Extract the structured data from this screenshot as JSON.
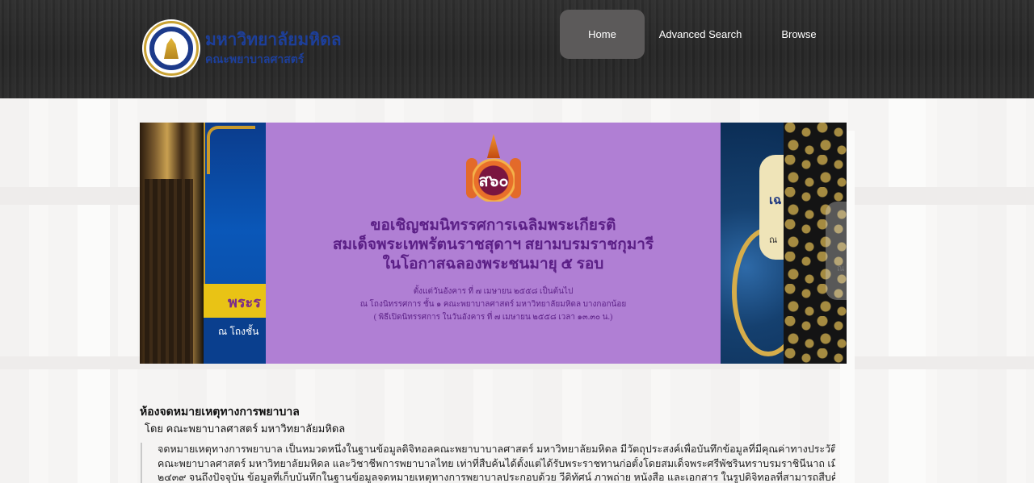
{
  "header": {
    "brand_title": "มหาวิทยาลัยมหิดล",
    "brand_subtitle": "คณะพยาบาลศาสตร์",
    "seal_icon": "mahidol-university-seal-icon"
  },
  "nav": {
    "items": [
      {
        "label": "Home",
        "active": true
      },
      {
        "label": "Advanced Search",
        "active": false
      },
      {
        "label": "Browse",
        "active": false
      }
    ]
  },
  "carousel": {
    "main_slide": {
      "line1": "ขอเชิญชมนิทรรศการเฉลิมพระเกียรติ",
      "line2": "สมเด็จพระเทพรัตนราชสุดาฯ สยามบรมราชกุมารี",
      "line3": "ในโอกาสฉลองพระชนมายุ ๕ รอบ",
      "detail1": "ตั้งแต่วันอังคาร ที่ ๗ เมษายน ๒๕๕๘ เป็นต้นไป",
      "detail2": "ณ โถงนิทรรศการ ชั้น ๑ คณะพยาบาลศาสตร์ มหาวิทยาลัยมหิดล บางกอกน้อย",
      "detail3": "( พิธีเปิดนิทรรศการ ในวันอังคาร ที่ ๗ เมษายน ๒๕๕๘ เวลา ๑๓.๓๐ น.)",
      "emblem_glyph": "ส๖๐"
    },
    "left_slide": {
      "yellow_text": "พระร",
      "blue_text": "ณ โถงชั้น"
    },
    "right_slide": {
      "frame_text": "เฉ",
      "frame_sub": "ณ"
    },
    "far_right_slide": {
      "panel_text": "ณ"
    },
    "colors": {
      "main_bg": "#b07fd4",
      "main_text": "#5b1f86"
    }
  },
  "content": {
    "title": "ห้องจดหมายเหตุทางการพยาบาล",
    "byline": "โดย คณะพยาบาลศาสตร์ มหาวิทยาลัยมหิดล",
    "paragraph_lines": [
      "จดหมายเหตุทางการพยาบาล เป็นหมวดหนึ่งในฐานข้อมูลดิจิทอลคณะพยาบาบาลศาสตร์ มหาวิทยาลัยมหิดล มีวัตถุประสงค์เพื่อบันทึกข้อมูลที่มีคุณค่าทางประวัติศาสตร์ของ",
      "คณะพยาบาลศาสตร์ มหาวิทยาลัยมหิดล และวิชาชีพการพยาบาลไทย เท่าที่สืบค้นได้ตั้งแต่ได้รับพระราชทานก่อตั้งโดยสมเด็จพระศรีพัชรินทราบรมราชินีนาถ เมื่อพุทธศักราช",
      "๒๔๓๙ จนถึงปัจจุบัน ข้อมูลที่เก็บบันทึกในฐานข้อมูลจดหมายเหตุทางการพยาบาลประกอบด้วย วีดิทัศน์ ภาพถ่าย หนังสือ และเอกสาร ในรูปดิจิทอลที่สามารถสืบค้นด้วยคำ"
    ]
  }
}
